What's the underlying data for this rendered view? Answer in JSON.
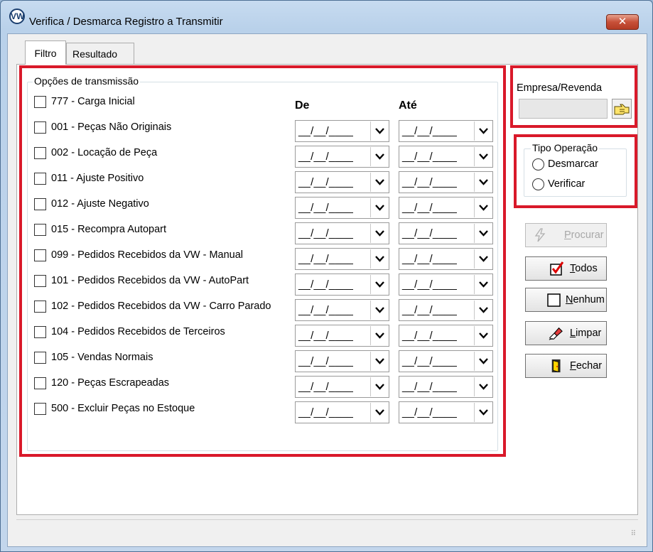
{
  "window": {
    "title": "Verifica / Desmarca Registro a Transmitir",
    "close_glyph": "✕"
  },
  "tabs": [
    {
      "label": "Filtro"
    },
    {
      "label": "Resultado"
    }
  ],
  "options_group": {
    "legend": "Opções de transmissão",
    "col_from": "De",
    "col_to": "Até",
    "date_mask": "__/__/____",
    "items": [
      {
        "label": "777 - Carga Inicial",
        "has_dates": false
      },
      {
        "label": "001 - Peças Não Originais",
        "has_dates": true
      },
      {
        "label": "002 - Locação de Peça",
        "has_dates": true
      },
      {
        "label": "011 - Ajuste Positivo",
        "has_dates": true
      },
      {
        "label": "012 - Ajuste Negativo",
        "has_dates": true
      },
      {
        "label": "015 - Recompra Autopart",
        "has_dates": true
      },
      {
        "label": "099 - Pedidos Recebidos da VW - Manual",
        "has_dates": true
      },
      {
        "label": "101 - Pedidos Recebidos da VW - AutoPart",
        "has_dates": true
      },
      {
        "label": "102 - Pedidos Recebidos da VW - Carro Parado",
        "has_dates": true
      },
      {
        "label": "104 - Pedidos Recebidos de Terceiros",
        "has_dates": true
      },
      {
        "label": "105 - Vendas Normais",
        "has_dates": true
      },
      {
        "label": "120 - Peças Escrapeadas",
        "has_dates": true
      },
      {
        "label": "500 - Excluir Peças no Estoque",
        "has_dates": true
      }
    ]
  },
  "empresa": {
    "label": "Empresa/Revenda",
    "value": ""
  },
  "tipo_operacao": {
    "legend": "Tipo Operação",
    "options": [
      {
        "label": "Desmarcar"
      },
      {
        "label": "Verificar"
      }
    ]
  },
  "buttons": {
    "procurar": {
      "first": "P",
      "rest": "rocurar",
      "enabled": false
    },
    "todos": {
      "first": "T",
      "rest": "odos"
    },
    "nenhum": {
      "first": "N",
      "rest": "enhum"
    },
    "limpar": {
      "first": "L",
      "rest": "impar"
    },
    "fechar": {
      "first": "F",
      "rest": "echar"
    }
  },
  "colors": {
    "highlight_border": "#d9192a",
    "title_bar": "#b9d1ea",
    "close_button": "#c75039"
  }
}
